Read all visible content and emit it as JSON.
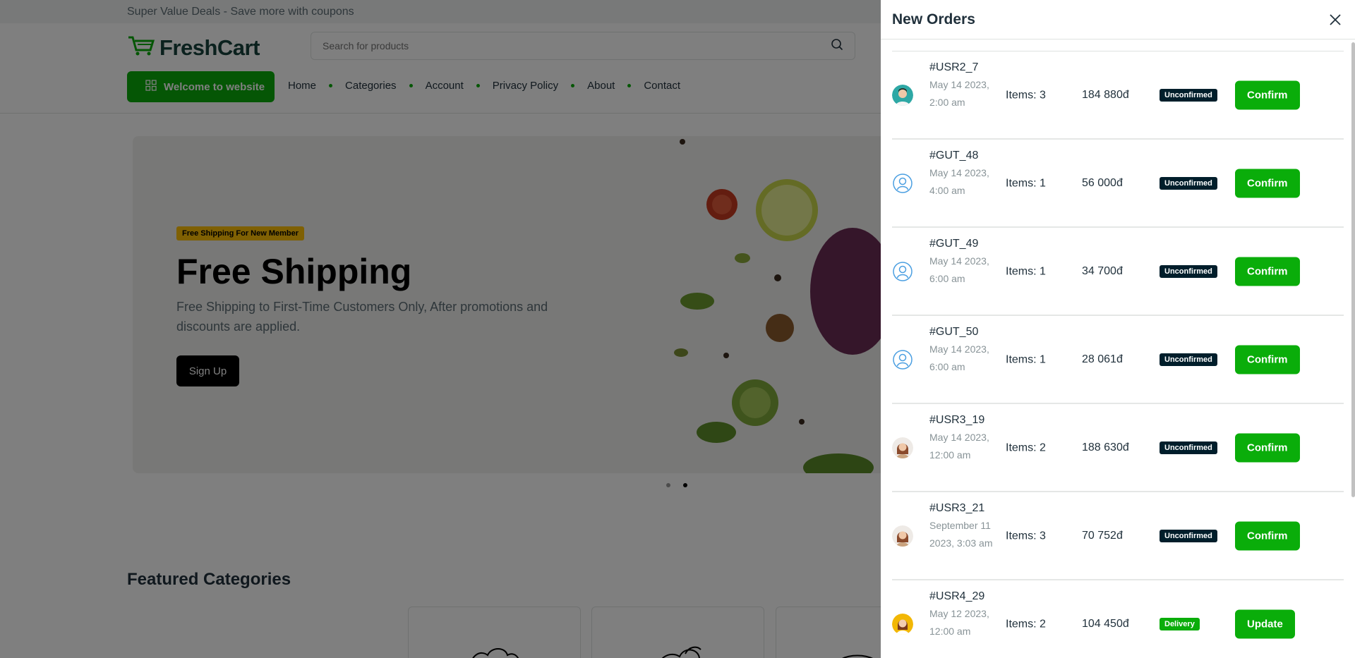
{
  "topbar": {
    "text": "Super Value Deals - Save more with coupons"
  },
  "header": {
    "logo_text": "FreshCart",
    "search_placeholder": "Search for products",
    "welcome_button": "Welcome to website",
    "nav": [
      "Home",
      "Categories",
      "Account",
      "Privacy Policy",
      "About",
      "Contact"
    ]
  },
  "hero": {
    "badge": "Free Shipping For New Member",
    "title": "Free Shipping",
    "description": "Free Shipping to First-Time Customers Only, After promotions and discounts are applied.",
    "button": "Sign Up"
  },
  "featured": {
    "title": "Featured Categories"
  },
  "drawer": {
    "title": "New Orders",
    "orders": [
      {
        "id": "#USR2_7",
        "date": "May 14 2023, 2:00 am",
        "items": "Items: 3",
        "total": "184 880đ",
        "status": "Unconfirmed",
        "action": "Confirm",
        "avatar": "photo-teal"
      },
      {
        "id": "#GUT_48",
        "date": "May 14 2023, 4:00 am",
        "items": "Items: 1",
        "total": "56 000đ",
        "status": "Unconfirmed",
        "action": "Confirm",
        "avatar": "user-outline"
      },
      {
        "id": "#GUT_49",
        "date": "May 14 2023, 6:00 am",
        "items": "Items: 1",
        "total": "34 700đ",
        "status": "Unconfirmed",
        "action": "Confirm",
        "avatar": "user-outline"
      },
      {
        "id": "#GUT_50",
        "date": "May 14 2023, 6:00 am",
        "items": "Items: 1",
        "total": "28 061đ",
        "status": "Unconfirmed",
        "action": "Confirm",
        "avatar": "user-outline"
      },
      {
        "id": "#USR3_19",
        "date": "May 14 2023, 12:00 am",
        "items": "Items: 2",
        "total": "188 630đ",
        "status": "Unconfirmed",
        "action": "Confirm",
        "avatar": "photo-light"
      },
      {
        "id": "#USR3_21",
        "date": "September 11 2023, 3:03 am",
        "items": "Items: 3",
        "total": "70 752đ",
        "status": "Unconfirmed",
        "action": "Confirm",
        "avatar": "photo-light"
      },
      {
        "id": "#USR4_29",
        "date": "May 12 2023, 12:00 am",
        "items": "Items: 2",
        "total": "104 450đ",
        "status": "Delivery",
        "action": "Update",
        "avatar": "photo-yellow"
      }
    ]
  },
  "colors": {
    "accent": "#0aad0a",
    "status_dark": "#001e2b",
    "badge_yellow": "#ffc107"
  }
}
